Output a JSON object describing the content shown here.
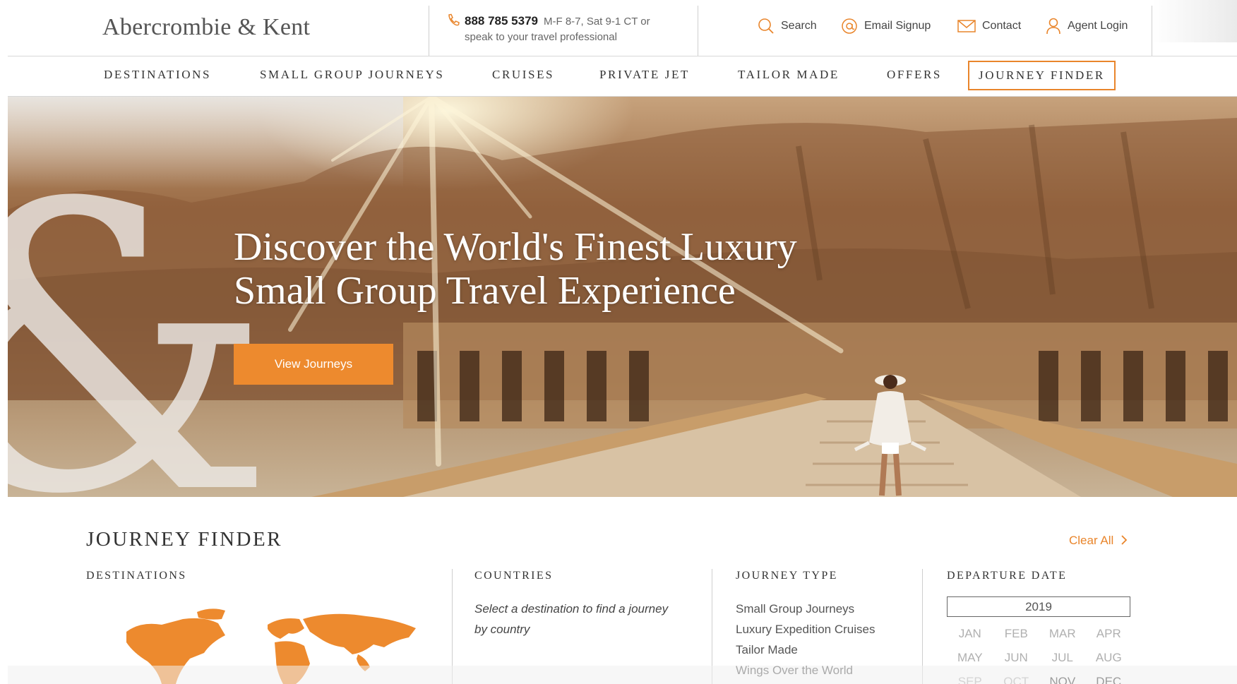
{
  "header": {
    "logo": "Abercrombie & Kent",
    "phone_number": "888 785 5379",
    "phone_hours": "M-F 8-7, Sat 9-1 CT or",
    "phone_sub": "speak to your travel professional",
    "utility_links": {
      "search": "Search",
      "email": "Email Signup",
      "contact": "Contact",
      "agent": "Agent Login"
    }
  },
  "nav": {
    "destinations": "DESTINATIONS",
    "small_group": "SMALL GROUP JOURNEYS",
    "cruises": "CRUISES",
    "private_jet": "PRIVATE JET",
    "tailor_made": "TAILOR MADE",
    "offers": "OFFERS",
    "journey_finder": "JOURNEY FINDER"
  },
  "hero": {
    "title_line1": "Discover the World's Finest Luxury",
    "title_line2": "Small Group Travel Experience",
    "cta": "View Journeys"
  },
  "journey_finder": {
    "title": "JOURNEY FINDER",
    "clear_all": "Clear All",
    "destinations_heading": "DESTINATIONS",
    "countries_heading": "COUNTRIES",
    "countries_hint": "Select a destination to find a journey by country",
    "journey_type_heading": "JOURNEY TYPE",
    "journey_types": [
      "Small Group Journeys",
      "Luxury Expedition Cruises",
      "Tailor Made",
      "Wings Over the World"
    ],
    "departure_heading": "DEPARTURE DATE",
    "year": "2019",
    "months": [
      {
        "label": "JAN",
        "enabled": false
      },
      {
        "label": "FEB",
        "enabled": false
      },
      {
        "label": "MAR",
        "enabled": false
      },
      {
        "label": "APR",
        "enabled": false
      },
      {
        "label": "MAY",
        "enabled": false
      },
      {
        "label": "JUN",
        "enabled": false
      },
      {
        "label": "JUL",
        "enabled": false
      },
      {
        "label": "AUG",
        "enabled": false
      },
      {
        "label": "SEP",
        "enabled": false
      },
      {
        "label": "OCT",
        "enabled": false
      },
      {
        "label": "NOV",
        "enabled": true
      },
      {
        "label": "DEC",
        "enabled": true
      }
    ]
  },
  "colors": {
    "accent": "#ed8a2e",
    "text": "#333333",
    "month_disabled": "#b0b0b0",
    "month_enabled": "#333333"
  },
  "icons": [
    "phone-icon",
    "search-icon",
    "at-icon",
    "envelope-icon",
    "user-icon",
    "chevron-right-icon",
    "world-map-icon"
  ]
}
